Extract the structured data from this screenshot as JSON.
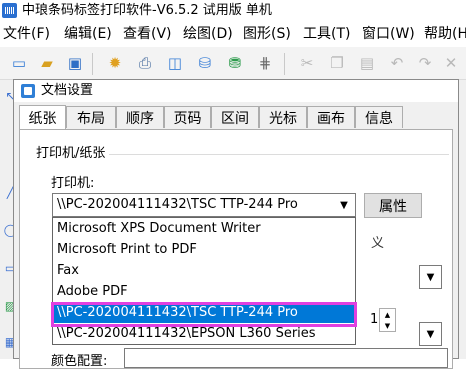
{
  "app": {
    "title": "中琅条码标签打印软件-V6.5.2 试用版 单机"
  },
  "menu": [
    {
      "label": "文件(F)"
    },
    {
      "label": "编辑(E)"
    },
    {
      "label": "查看(V)"
    },
    {
      "label": "绘图(D)"
    },
    {
      "label": "图形(S)"
    },
    {
      "label": "工具(T)"
    },
    {
      "label": "窗口(W)"
    },
    {
      "label": "帮助(H)"
    }
  ],
  "dialog": {
    "title": "文档设置",
    "tabs": [
      "纸张",
      "布局",
      "顺序",
      "页码",
      "区间",
      "光标",
      "画布",
      "信息"
    ],
    "active_tab": "纸张",
    "group_label": "打印机/纸张",
    "printer_label": "打印机:",
    "printer_value": "\\\\PC-202004111432\\TSC TTP-244 Pro",
    "properties_button": "属性",
    "printer_options": [
      "Microsoft XPS Document Writer",
      "Microsoft Print to PDF",
      "Fax",
      "Adobe PDF",
      "\\\\PC-202004111432\\TSC TTP-244 Pro",
      "\\\\PC-202004111432\\EPSON L360 Series"
    ],
    "selected_option_index": 4,
    "partial_label": "义",
    "spinner_value": "1",
    "color_label": "颜色配置:"
  },
  "colors": {
    "selection": "#0078d7",
    "highlight": "#e040e0"
  }
}
